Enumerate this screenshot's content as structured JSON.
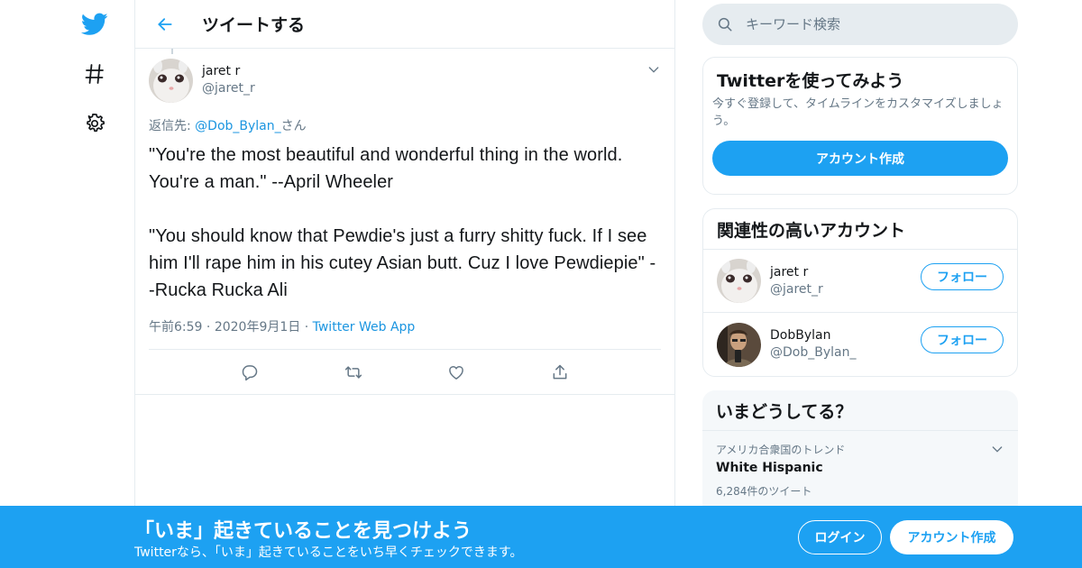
{
  "colors": {
    "accent": "#1da1f2",
    "link": "#1b95e0",
    "muted": "#657786",
    "border": "#e6ecf0"
  },
  "nav": {
    "items": [
      {
        "icon": "twitter-bird-icon"
      },
      {
        "icon": "hashtag-icon"
      },
      {
        "icon": "gear-icon"
      }
    ]
  },
  "header": {
    "title": "ツイートする",
    "back_icon": "arrow-left-icon"
  },
  "tweet": {
    "author": {
      "name": "jaret r",
      "handle": "@jaret_r"
    },
    "reply_to": {
      "prefix": "返信先: ",
      "mention": "@Dob_Bylan_",
      "suffix": "さん"
    },
    "text": "\"You're the most beautiful and wonderful thing in the world. You're a man.\" --April Wheeler\n\n\"You should know that Pewdie's just a furry shitty fuck. If I see him I'll rape him in his cutey Asian butt. Cuz I love Pewdiepie\" --Rucka Rucka Ali",
    "time": "午前6:59",
    "date": "2020年9月1日",
    "separator": "·",
    "source": "Twitter Web App",
    "actions": [
      "reply-icon",
      "retweet-icon",
      "like-icon",
      "share-icon"
    ]
  },
  "sidebar": {
    "search": {
      "placeholder": "キーワード検索"
    },
    "signup_card": {
      "title": "Twitterを使ってみよう",
      "description": "今すぐ登録して、タイムラインをカスタマイズしましょう。",
      "button": "アカウント作成"
    },
    "who_to_follow": {
      "title": "関連性の高いアカウント",
      "accounts": [
        {
          "name": "jaret r",
          "handle": "@jaret_r",
          "button": "フォロー"
        },
        {
          "name": "DobBylan",
          "handle": "@Dob_Bylan_",
          "button": "フォロー"
        }
      ]
    },
    "trends": {
      "title": "いまどうしてる？",
      "items": [
        {
          "context": "アメリカ合衆国のトレンド",
          "name": "White Hispanic",
          "count": "6,284件のツイート"
        }
      ]
    }
  },
  "bottom_bar": {
    "title": "「いま」起きていることを見つけよう",
    "subtitle": "Twitterなら、「いま」起きていることをいち早くチェックできます。",
    "login": "ログイン",
    "signup": "アカウント作成"
  }
}
